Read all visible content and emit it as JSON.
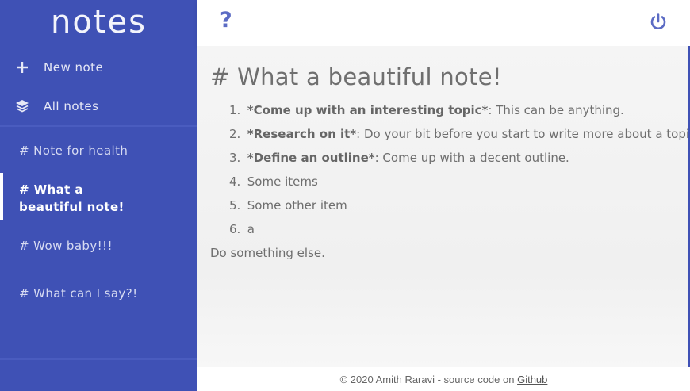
{
  "app": {
    "title": "notes"
  },
  "sidebar": {
    "nav": [
      {
        "label": "New note",
        "icon": "plus-icon"
      },
      {
        "label": "All notes",
        "icon": "layers-icon"
      }
    ],
    "notes": [
      {
        "label": "# Note for health"
      },
      {
        "label": "# What a beautiful note!",
        "active": true
      },
      {
        "label": "# Wow baby!!!"
      },
      {
        "label": "# What can I say?!"
      }
    ]
  },
  "header": {
    "help_label": "?",
    "power_icon": "power-icon"
  },
  "editor": {
    "title": "# What a beautiful note!",
    "items": [
      {
        "num": "1.",
        "bold": "*Come up with an interesting topic*",
        "text": ": This can be anything."
      },
      {
        "num": "2.",
        "bold": "*Research on it*",
        "text": ": Do your bit before you start to write more about a topic."
      },
      {
        "num": "3.",
        "bold": "*Define an outline*",
        "text": ": Come up with a decent outline."
      },
      {
        "num": "4.",
        "bold": "",
        "text": "Some items"
      },
      {
        "num": "5.",
        "bold": "",
        "text": "Some other item"
      },
      {
        "num": "6.",
        "bold": "",
        "text": " a"
      }
    ],
    "closing": "Do something else."
  },
  "footer": {
    "text": "© 2020 Amith Raravi - source code on ",
    "link": "Github"
  },
  "colors": {
    "accent": "#3f51b5",
    "icon": "#5b6bc4"
  }
}
